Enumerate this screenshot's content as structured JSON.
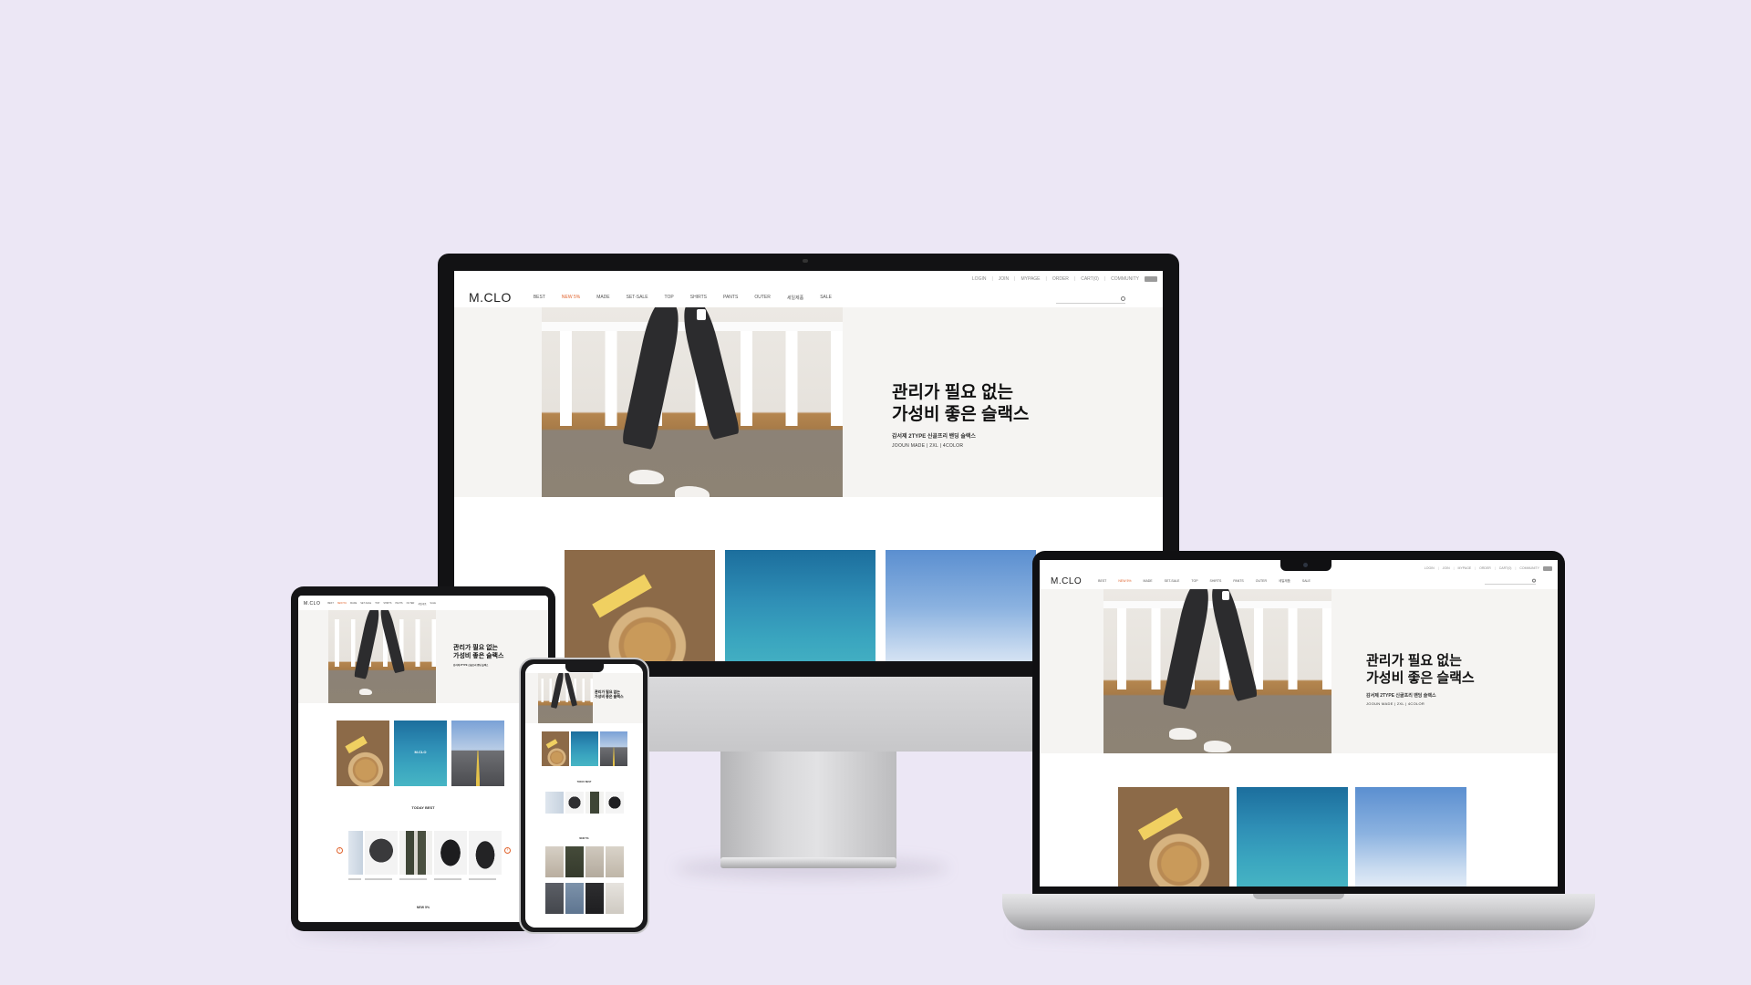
{
  "site": {
    "logo": "M.CLO",
    "utility_links": [
      "LOGIN",
      "JOIN",
      "MYPAGE",
      "ORDER",
      "CART(0)",
      "COMMUNITY"
    ],
    "nav_items": [
      {
        "label": "BEST",
        "active": false
      },
      {
        "label": "NEW 5%",
        "active": true
      },
      {
        "label": "MADE",
        "active": false
      },
      {
        "label": "SET-SALE",
        "active": false
      },
      {
        "label": "TOP",
        "active": false
      },
      {
        "label": "SHIRTS",
        "active": false
      },
      {
        "label": "PANTS",
        "active": false
      },
      {
        "label": "OUTER",
        "active": false
      },
      {
        "label": "세일제품",
        "active": false
      },
      {
        "label": "SALE",
        "active": false
      }
    ],
    "hero": {
      "headline": "관리가 필요 없는\n가성비 좋은 슬랙스",
      "subline": "감서제 2TYPE 신골프리 밴딩 슬랙스",
      "tagline": "JOOUN MADE | 2XL | 4COLOR"
    },
    "section_title": "TODAY BEST",
    "section_title_2": "NEW 5%",
    "banner_caption": "M.CLO"
  },
  "colors": {
    "background": "#ece7f5",
    "accent": "#e0622b",
    "device_frame": "#121214"
  }
}
